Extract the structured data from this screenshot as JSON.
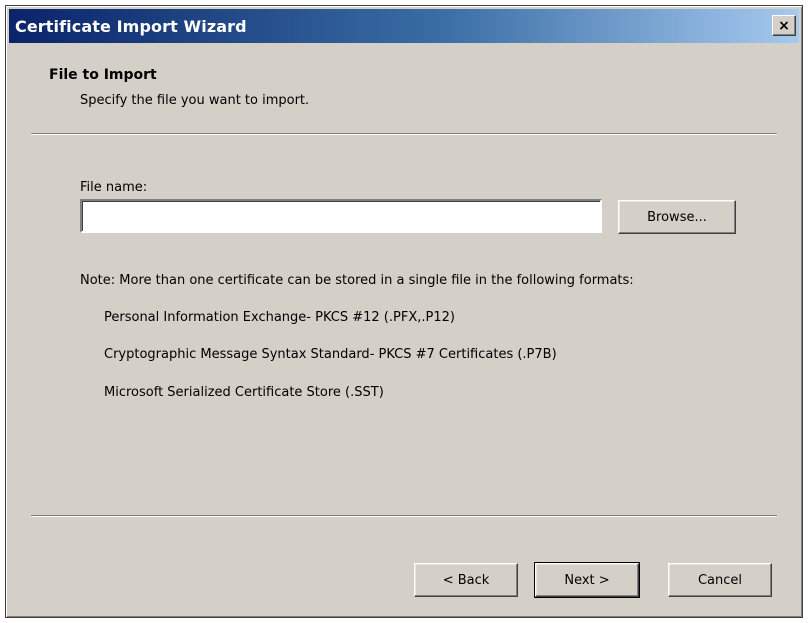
{
  "window": {
    "title": "Certificate Import Wizard",
    "close_label": "×"
  },
  "header": {
    "title": "File to Import",
    "subtitle": "Specify the file you want to import."
  },
  "file": {
    "label": "File name:",
    "value": "",
    "placeholder": "",
    "browse_label": "Browse..."
  },
  "note": {
    "text": "Note:  More than one certificate can be stored in a single file in the following formats:",
    "formats": [
      "Personal Information Exchange- PKCS #12 (.PFX,.P12)",
      "Cryptographic Message Syntax Standard- PKCS #7 Certificates (.P7B)",
      "Microsoft Serialized Certificate Store (.SST)"
    ]
  },
  "footer": {
    "back_label": "< Back",
    "next_label": "Next >",
    "cancel_label": "Cancel"
  }
}
